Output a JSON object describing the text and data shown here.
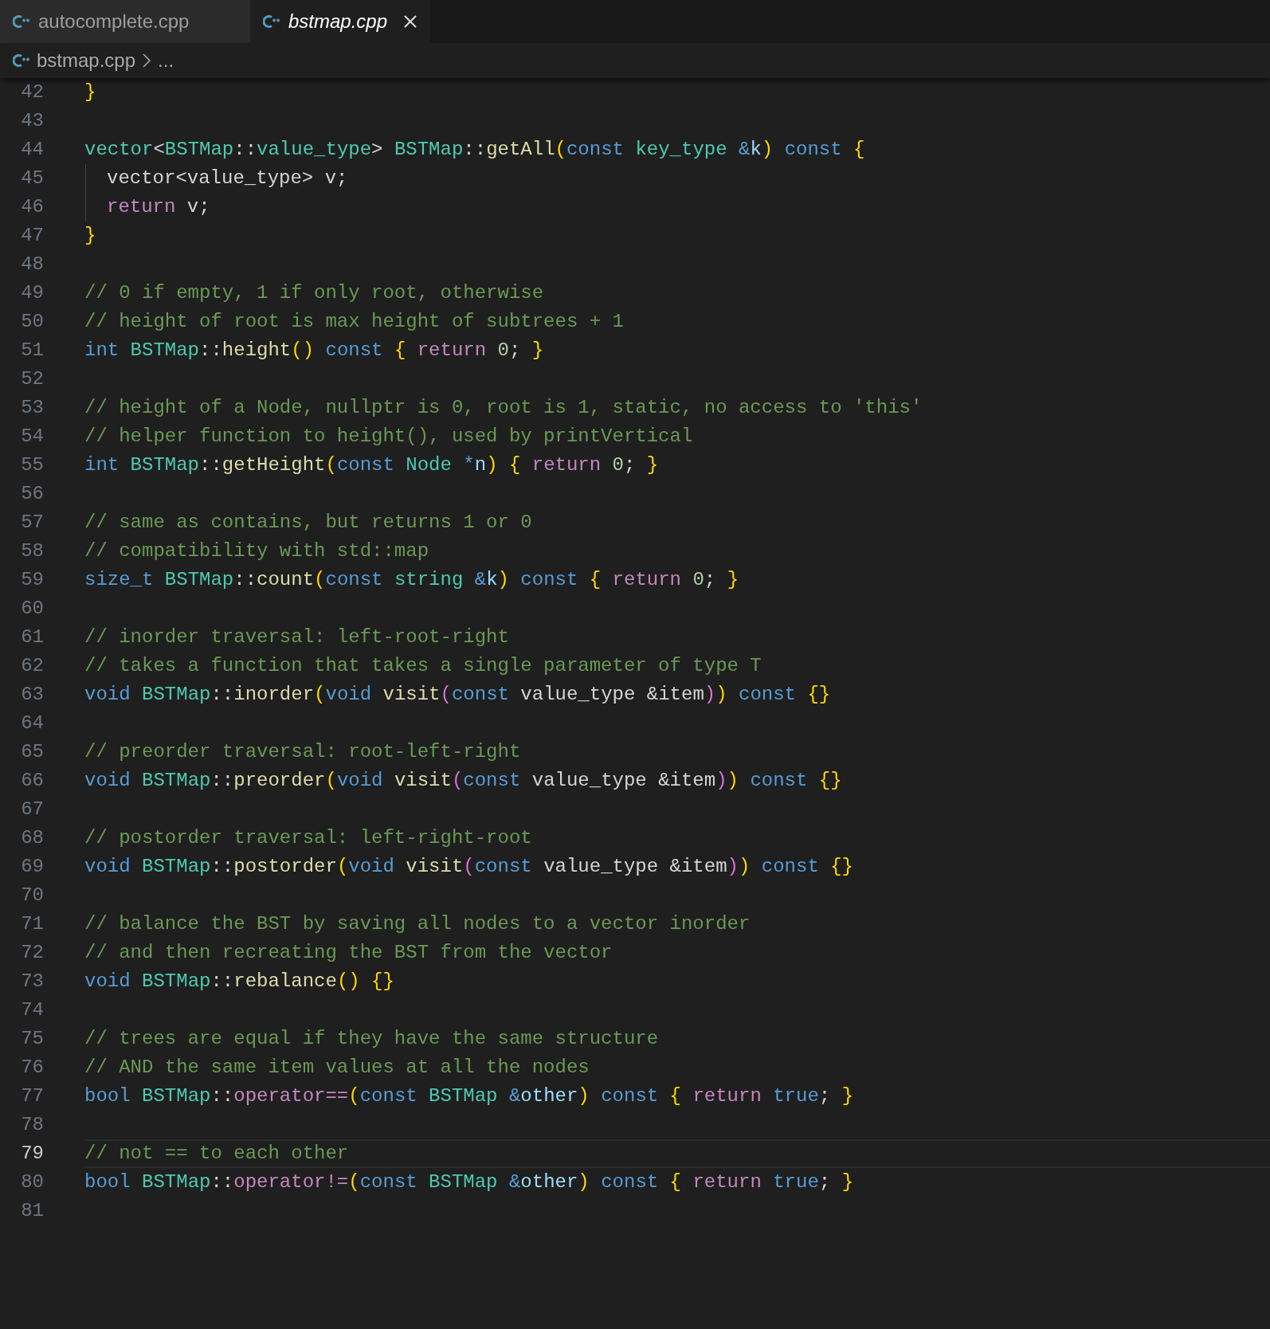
{
  "tabs": [
    {
      "label": "autocomplete.cpp",
      "selected": false,
      "preview": false
    },
    {
      "label": "bstmap.cpp",
      "selected": true,
      "preview": true
    }
  ],
  "breadcrumb": {
    "file": "bstmap.cpp",
    "more": "..."
  },
  "lines": [
    {
      "number": "42",
      "current": false,
      "indent": false,
      "tokens": [
        {
          "kind": "b1",
          "text": "}"
        }
      ]
    },
    {
      "number": "43",
      "current": false,
      "indent": false
    },
    {
      "number": "44",
      "current": false,
      "indent": false,
      "tokens": [
        {
          "kind": "ty",
          "text": "vector"
        },
        {
          "kind": "p",
          "text": "<"
        },
        {
          "kind": "ty",
          "text": "BSTMap"
        },
        {
          "kind": "p",
          "text": "::"
        },
        {
          "kind": "ty",
          "text": "value_type"
        },
        {
          "kind": "p",
          "text": "> "
        },
        {
          "kind": "ty",
          "text": "BSTMap"
        },
        {
          "kind": "p",
          "text": "::"
        },
        {
          "kind": "fn",
          "text": "getAll"
        },
        {
          "kind": "b1",
          "text": "("
        },
        {
          "kind": "kw",
          "text": "const "
        },
        {
          "kind": "ty",
          "text": "key_type "
        },
        {
          "kind": "kw",
          "text": "&"
        },
        {
          "kind": "var",
          "text": "k"
        },
        {
          "kind": "b1",
          "text": ")"
        },
        {
          "kind": "kw",
          "text": " const "
        },
        {
          "kind": "b1",
          "text": "{"
        }
      ]
    },
    {
      "number": "45",
      "current": false,
      "indent": true,
      "tokens": [
        {
          "kind": "p",
          "text": "vector<value_type> v;"
        }
      ]
    },
    {
      "number": "46",
      "current": false,
      "indent": true,
      "tokens": [
        {
          "kind": "ctl",
          "text": "return"
        },
        {
          "kind": "p",
          "text": " v;"
        }
      ]
    },
    {
      "number": "47",
      "current": false,
      "indent": false,
      "tokens": [
        {
          "kind": "b1",
          "text": "}"
        }
      ]
    },
    {
      "number": "48",
      "current": false,
      "indent": false
    },
    {
      "number": "49",
      "current": false,
      "indent": false,
      "tokens": [
        {
          "kind": "cm",
          "text": "// 0 if empty, 1 if only root, otherwise"
        }
      ]
    },
    {
      "number": "50",
      "current": false,
      "indent": false,
      "tokens": [
        {
          "kind": "cm",
          "text": "// height of root is max height of subtrees + 1"
        }
      ]
    },
    {
      "number": "51",
      "current": false,
      "indent": false,
      "tokens": [
        {
          "kind": "kw",
          "text": "int "
        },
        {
          "kind": "ty",
          "text": "BSTMap"
        },
        {
          "kind": "p",
          "text": "::"
        },
        {
          "kind": "fn",
          "text": "height"
        },
        {
          "kind": "b1",
          "text": "()"
        },
        {
          "kind": "kw",
          "text": " const "
        },
        {
          "kind": "b1",
          "text": "{"
        },
        {
          "kind": "ctl",
          "text": " return "
        },
        {
          "kind": "num",
          "text": "0"
        },
        {
          "kind": "p",
          "text": "; "
        },
        {
          "kind": "b1",
          "text": "}"
        }
      ]
    },
    {
      "number": "52",
      "current": false,
      "indent": false
    },
    {
      "number": "53",
      "current": false,
      "indent": false,
      "tokens": [
        {
          "kind": "cm",
          "text": "// height of a Node, nullptr is 0, root is 1, static, no access to 'this'"
        }
      ]
    },
    {
      "number": "54",
      "current": false,
      "indent": false,
      "tokens": [
        {
          "kind": "cm",
          "text": "// helper function to height(), used by printVertical"
        }
      ]
    },
    {
      "number": "55",
      "current": false,
      "indent": false,
      "tokens": [
        {
          "kind": "kw",
          "text": "int "
        },
        {
          "kind": "ty",
          "text": "BSTMap"
        },
        {
          "kind": "p",
          "text": "::"
        },
        {
          "kind": "fn",
          "text": "getHeight"
        },
        {
          "kind": "b1",
          "text": "("
        },
        {
          "kind": "kw",
          "text": "const "
        },
        {
          "kind": "ty",
          "text": "Node "
        },
        {
          "kind": "kw",
          "text": "*"
        },
        {
          "kind": "var",
          "text": "n"
        },
        {
          "kind": "b1",
          "text": ")"
        },
        {
          "kind": "b1",
          "text": " {"
        },
        {
          "kind": "ctl",
          "text": " return "
        },
        {
          "kind": "num",
          "text": "0"
        },
        {
          "kind": "p",
          "text": "; "
        },
        {
          "kind": "b1",
          "text": "}"
        }
      ]
    },
    {
      "number": "56",
      "current": false,
      "indent": false
    },
    {
      "number": "57",
      "current": false,
      "indent": false,
      "tokens": [
        {
          "kind": "cm",
          "text": "// same as contains, but returns 1 or 0"
        }
      ]
    },
    {
      "number": "58",
      "current": false,
      "indent": false,
      "tokens": [
        {
          "kind": "cm",
          "text": "// compatibility with std::map"
        }
      ]
    },
    {
      "number": "59",
      "current": false,
      "indent": false,
      "tokens": [
        {
          "kind": "kw",
          "text": "size_t "
        },
        {
          "kind": "ty",
          "text": "BSTMap"
        },
        {
          "kind": "p",
          "text": "::"
        },
        {
          "kind": "fn",
          "text": "count"
        },
        {
          "kind": "b1",
          "text": "("
        },
        {
          "kind": "kw",
          "text": "const "
        },
        {
          "kind": "ty",
          "text": "string "
        },
        {
          "kind": "kw",
          "text": "&"
        },
        {
          "kind": "var",
          "text": "k"
        },
        {
          "kind": "b1",
          "text": ")"
        },
        {
          "kind": "kw",
          "text": " const "
        },
        {
          "kind": "b1",
          "text": "{"
        },
        {
          "kind": "ctl",
          "text": " return "
        },
        {
          "kind": "num",
          "text": "0"
        },
        {
          "kind": "p",
          "text": "; "
        },
        {
          "kind": "b1",
          "text": "}"
        }
      ]
    },
    {
      "number": "60",
      "current": false,
      "indent": false
    },
    {
      "number": "61",
      "current": false,
      "indent": false,
      "tokens": [
        {
          "kind": "cm",
          "text": "// inorder traversal: left-root-right"
        }
      ]
    },
    {
      "number": "62",
      "current": false,
      "indent": false,
      "tokens": [
        {
          "kind": "cm",
          "text": "// takes a function that takes a single parameter of type T"
        }
      ]
    },
    {
      "number": "63",
      "current": false,
      "indent": false,
      "tokens": [
        {
          "kind": "kw",
          "text": "void "
        },
        {
          "kind": "ty",
          "text": "BSTMap"
        },
        {
          "kind": "p",
          "text": "::"
        },
        {
          "kind": "fn",
          "text": "inorder"
        },
        {
          "kind": "b1",
          "text": "("
        },
        {
          "kind": "kw",
          "text": "void "
        },
        {
          "kind": "fn",
          "text": "visit"
        },
        {
          "kind": "b2",
          "text": "("
        },
        {
          "kind": "kw",
          "text": "const "
        },
        {
          "kind": "p",
          "text": "value_type &item"
        },
        {
          "kind": "b2",
          "text": ")"
        },
        {
          "kind": "b1",
          "text": ")"
        },
        {
          "kind": "kw",
          "text": " const "
        },
        {
          "kind": "b1",
          "text": "{}"
        }
      ]
    },
    {
      "number": "64",
      "current": false,
      "indent": false
    },
    {
      "number": "65",
      "current": false,
      "indent": false,
      "tokens": [
        {
          "kind": "cm",
          "text": "// preorder traversal: root-left-right"
        }
      ]
    },
    {
      "number": "66",
      "current": false,
      "indent": false,
      "tokens": [
        {
          "kind": "kw",
          "text": "void "
        },
        {
          "kind": "ty",
          "text": "BSTMap"
        },
        {
          "kind": "p",
          "text": "::"
        },
        {
          "kind": "fn",
          "text": "preorder"
        },
        {
          "kind": "b1",
          "text": "("
        },
        {
          "kind": "kw",
          "text": "void "
        },
        {
          "kind": "fn",
          "text": "visit"
        },
        {
          "kind": "b2",
          "text": "("
        },
        {
          "kind": "kw",
          "text": "const "
        },
        {
          "kind": "p",
          "text": "value_type &item"
        },
        {
          "kind": "b2",
          "text": ")"
        },
        {
          "kind": "b1",
          "text": ")"
        },
        {
          "kind": "kw",
          "text": " const "
        },
        {
          "kind": "b1",
          "text": "{}"
        }
      ]
    },
    {
      "number": "67",
      "current": false,
      "indent": false
    },
    {
      "number": "68",
      "current": false,
      "indent": false,
      "tokens": [
        {
          "kind": "cm",
          "text": "// postorder traversal: left-right-root"
        }
      ]
    },
    {
      "number": "69",
      "current": false,
      "indent": false,
      "tokens": [
        {
          "kind": "kw",
          "text": "void "
        },
        {
          "kind": "ty",
          "text": "BSTMap"
        },
        {
          "kind": "p",
          "text": "::"
        },
        {
          "kind": "fn",
          "text": "postorder"
        },
        {
          "kind": "b1",
          "text": "("
        },
        {
          "kind": "kw",
          "text": "void "
        },
        {
          "kind": "fn",
          "text": "visit"
        },
        {
          "kind": "b2",
          "text": "("
        },
        {
          "kind": "kw",
          "text": "const "
        },
        {
          "kind": "p",
          "text": "value_type &item"
        },
        {
          "kind": "b2",
          "text": ")"
        },
        {
          "kind": "b1",
          "text": ")"
        },
        {
          "kind": "kw",
          "text": " const "
        },
        {
          "kind": "b1",
          "text": "{}"
        }
      ]
    },
    {
      "number": "70",
      "current": false,
      "indent": false
    },
    {
      "number": "71",
      "current": false,
      "indent": false,
      "tokens": [
        {
          "kind": "cm",
          "text": "// balance the BST by saving all nodes to a vector inorder"
        }
      ]
    },
    {
      "number": "72",
      "current": false,
      "indent": false,
      "tokens": [
        {
          "kind": "cm",
          "text": "// and then recreating the BST from the vector"
        }
      ]
    },
    {
      "number": "73",
      "current": false,
      "indent": false,
      "tokens": [
        {
          "kind": "kw",
          "text": "void "
        },
        {
          "kind": "ty",
          "text": "BSTMap"
        },
        {
          "kind": "p",
          "text": "::"
        },
        {
          "kind": "fn",
          "text": "rebalance"
        },
        {
          "kind": "b1",
          "text": "()"
        },
        {
          "kind": "b1",
          "text": " {}"
        }
      ]
    },
    {
      "number": "74",
      "current": false,
      "indent": false
    },
    {
      "number": "75",
      "current": false,
      "indent": false,
      "tokens": [
        {
          "kind": "cm",
          "text": "// trees are equal if they have the same structure"
        }
      ]
    },
    {
      "number": "76",
      "current": false,
      "indent": false,
      "tokens": [
        {
          "kind": "cm",
          "text": "// AND the same item values at all the nodes"
        }
      ]
    },
    {
      "number": "77",
      "current": false,
      "indent": false,
      "tokens": [
        {
          "kind": "kw",
          "text": "bool "
        },
        {
          "kind": "ty",
          "text": "BSTMap"
        },
        {
          "kind": "p",
          "text": "::"
        },
        {
          "kind": "ctl",
          "text": "operator=="
        },
        {
          "kind": "b1",
          "text": "("
        },
        {
          "kind": "kw",
          "text": "const "
        },
        {
          "kind": "ty",
          "text": "BSTMap "
        },
        {
          "kind": "kw",
          "text": "&"
        },
        {
          "kind": "var",
          "text": "other"
        },
        {
          "kind": "b1",
          "text": ")"
        },
        {
          "kind": "kw",
          "text": " const "
        },
        {
          "kind": "b1",
          "text": "{"
        },
        {
          "kind": "ctl",
          "text": " return "
        },
        {
          "kind": "kw",
          "text": "true"
        },
        {
          "kind": "p",
          "text": "; "
        },
        {
          "kind": "b1",
          "text": "}"
        }
      ]
    },
    {
      "number": "78",
      "current": false,
      "indent": false
    },
    {
      "number": "79",
      "current": true,
      "indent": false,
      "tokens": [
        {
          "kind": "cm",
          "text": "// not == to each other"
        }
      ]
    },
    {
      "number": "80",
      "current": false,
      "indent": false,
      "tokens": [
        {
          "kind": "kw",
          "text": "bool "
        },
        {
          "kind": "ty",
          "text": "BSTMap"
        },
        {
          "kind": "p",
          "text": "::"
        },
        {
          "kind": "ctl",
          "text": "operator!="
        },
        {
          "kind": "b1",
          "text": "("
        },
        {
          "kind": "kw",
          "text": "const "
        },
        {
          "kind": "ty",
          "text": "BSTMap "
        },
        {
          "kind": "kw",
          "text": "&"
        },
        {
          "kind": "var",
          "text": "other"
        },
        {
          "kind": "b1",
          "text": ")"
        },
        {
          "kind": "kw",
          "text": " const "
        },
        {
          "kind": "b1",
          "text": "{"
        },
        {
          "kind": "ctl",
          "text": " return "
        },
        {
          "kind": "kw",
          "text": "true"
        },
        {
          "kind": "p",
          "text": "; "
        },
        {
          "kind": "b1",
          "text": "}"
        }
      ]
    },
    {
      "number": "81",
      "current": false,
      "indent": false
    }
  ]
}
